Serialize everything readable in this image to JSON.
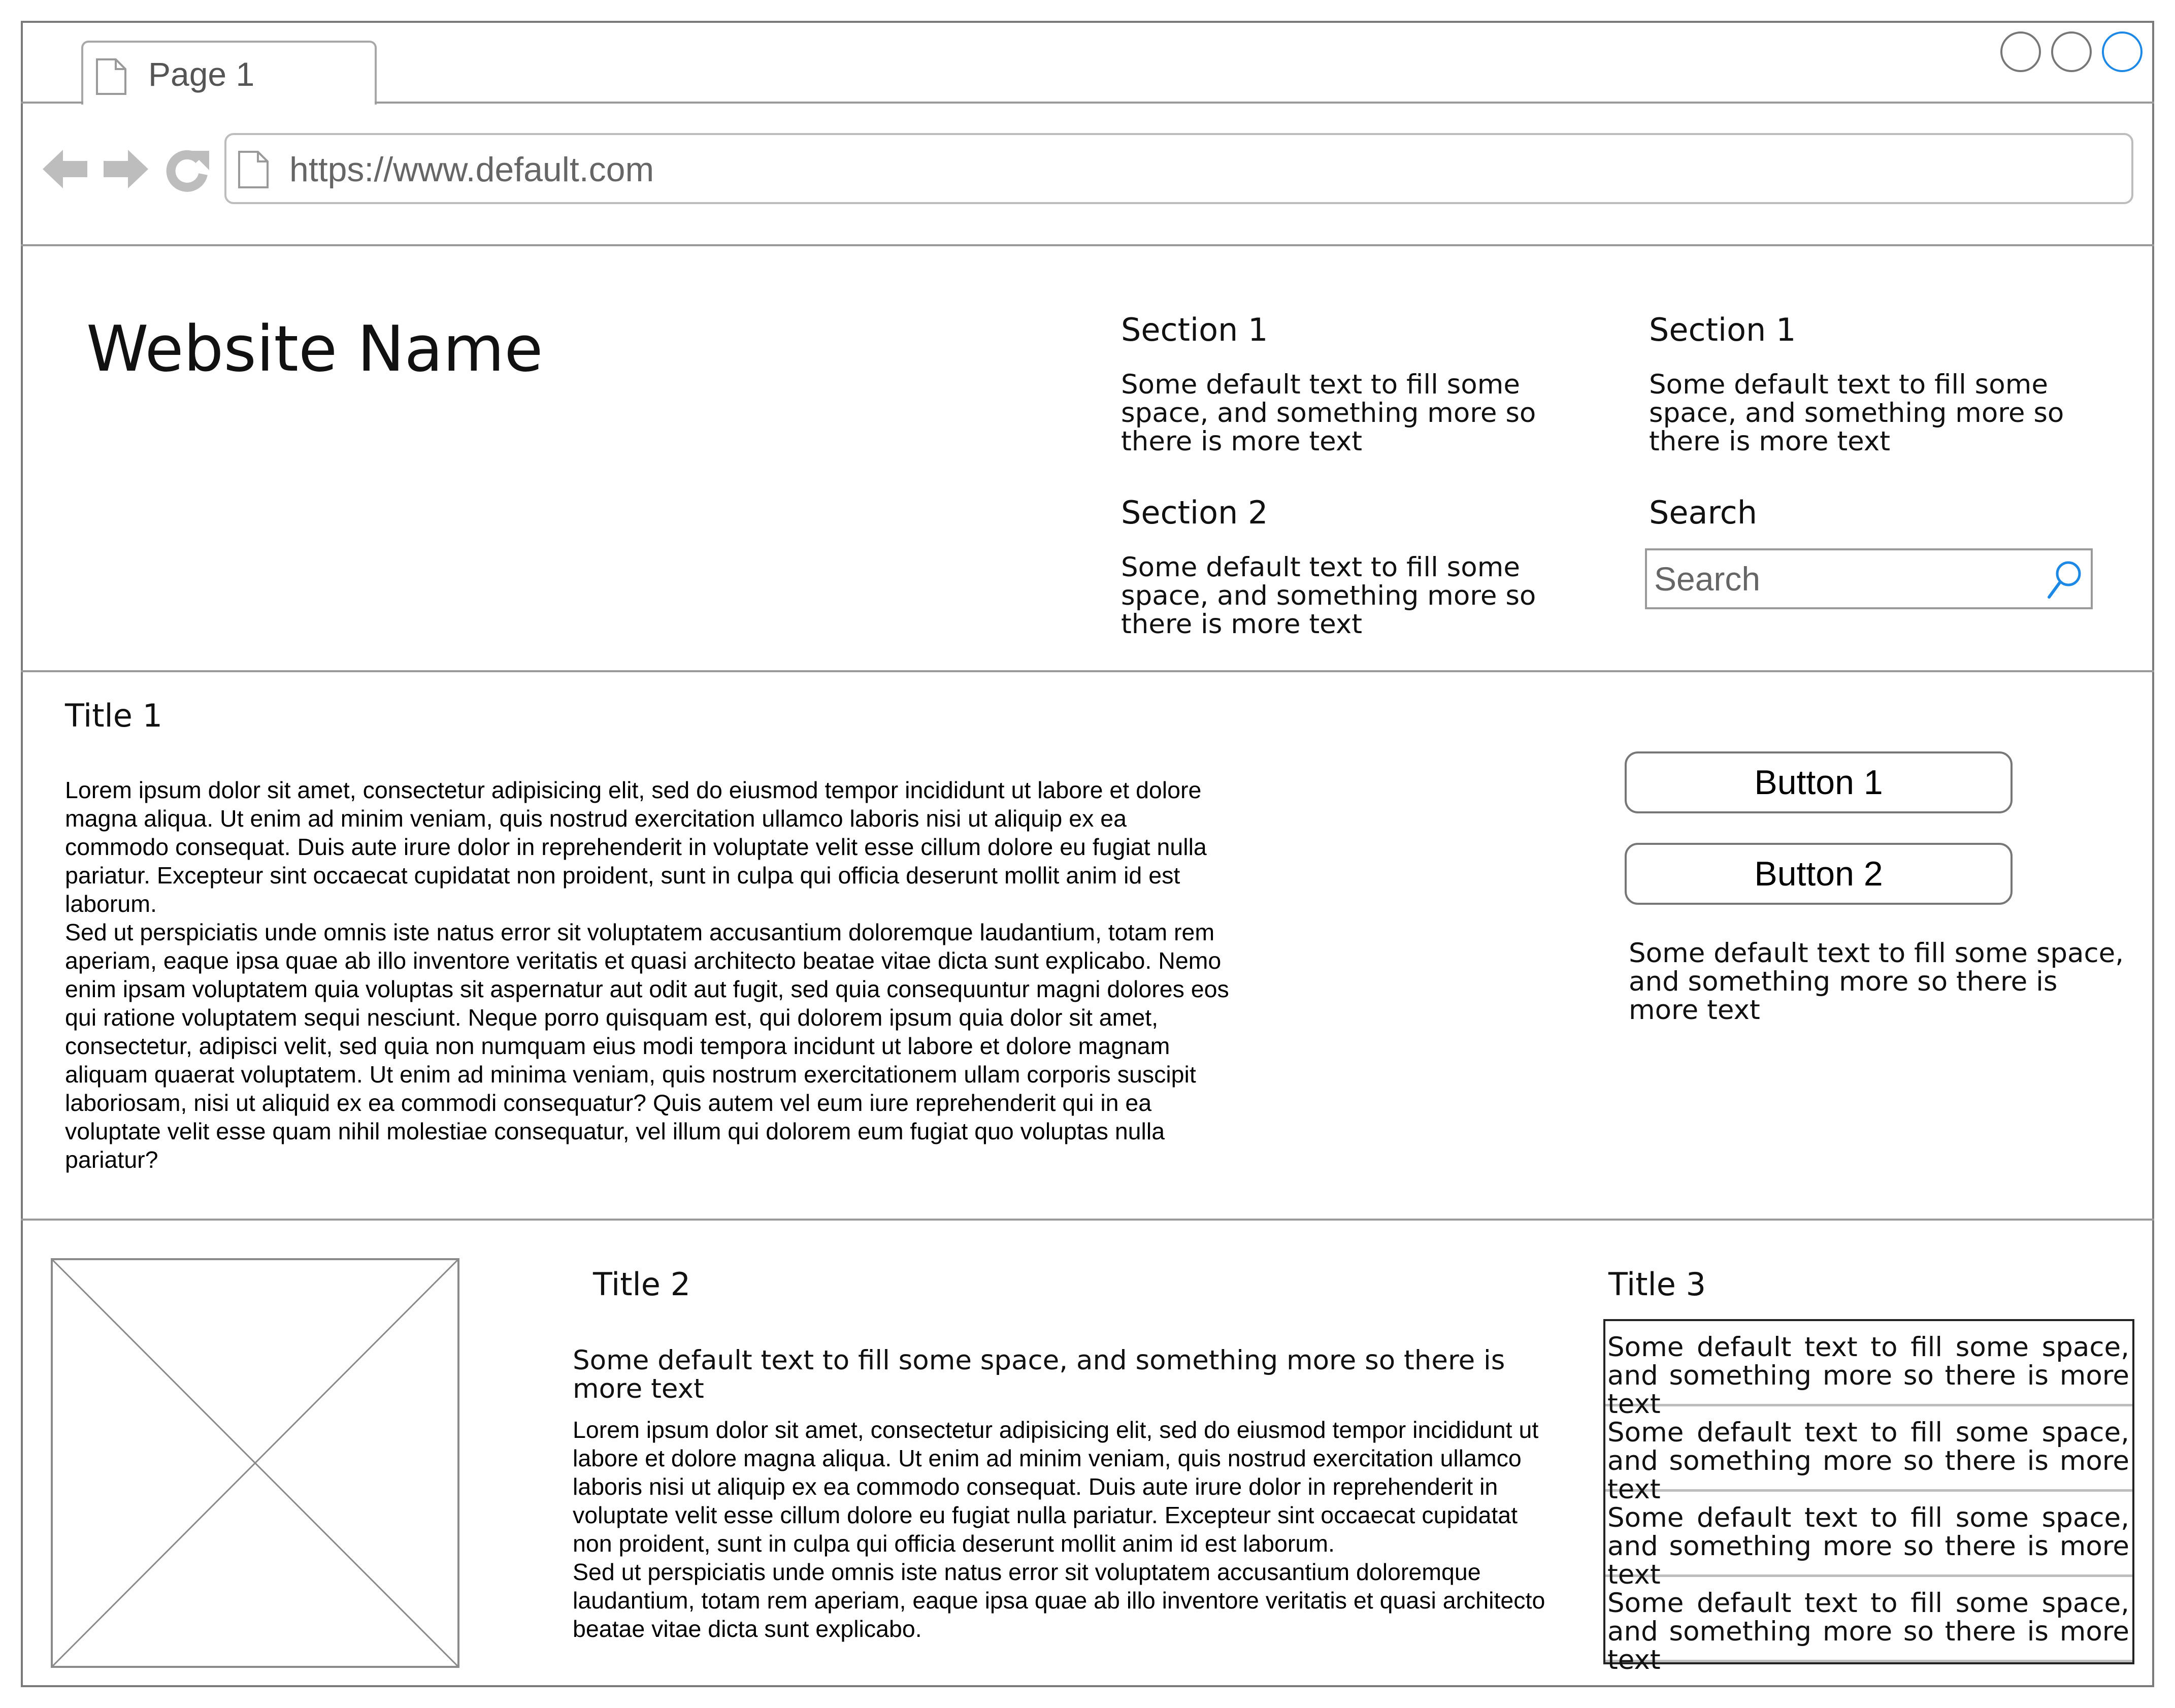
{
  "browser": {
    "tab_label": "Page 1",
    "url": "https://www.default.com",
    "accent_color": "#1e88e5"
  },
  "header": {
    "site_name": "Website Name",
    "sections": [
      {
        "title": "Section 1",
        "text": "Some default text to fill some space, and something more so there is more text"
      },
      {
        "title": "Section 1",
        "text": "Some default text to fill some space, and something more so there is more text"
      },
      {
        "title": "Section 2",
        "text": "Some default text to fill some space, and something more so there is more text"
      }
    ],
    "search": {
      "title": "Search",
      "placeholder": "Search"
    }
  },
  "main": {
    "title": "Title 1",
    "body": "Lorem ipsum dolor sit amet, consectetur adipisicing elit, sed do eiusmod tempor incididunt ut labore et dolore magna aliqua. Ut enim ad minim veniam, quis nostrud exercitation ullamco laboris nisi ut aliquip ex ea commodo consequat. Duis aute irure dolor in reprehenderit in voluptate velit esse cillum dolore eu fugiat nulla pariatur. Excepteur sint occaecat cupidatat non proident, sunt in culpa qui officia deserunt mollit anim id est laborum.\nSed ut perspiciatis unde omnis iste natus error sit voluptatem accusantium doloremque laudantium, totam rem aperiam, eaque ipsa quae ab illo inventore veritatis et quasi architecto beatae vitae dicta sunt explicabo. Nemo enim ipsam voluptatem quia voluptas sit aspernatur aut odit aut fugit, sed quia consequuntur magni dolores eos qui ratione voluptatem sequi nesciunt. Neque porro quisquam est, qui dolorem ipsum quia dolor sit amet, consectetur, adipisci velit, sed quia non numquam eius modi tempora incidunt ut labore et dolore magnam aliquam quaerat voluptatem. Ut enim ad minima veniam, quis nostrum exercitationem ullam corporis suscipit laboriosam, nisi ut aliquid ex ea commodi consequatur? Quis autem vel eum iure reprehenderit qui in ea voluptate velit esse quam nihil molestiae consequatur, vel illum qui dolorem eum fugiat quo voluptas nulla pariatur?",
    "button1_label": "Button 1",
    "button2_label": "Button 2",
    "side_text": "Some default text to fill some space, and something more so there is more text"
  },
  "bottom": {
    "title2": "Title 2",
    "subtitle2": "Some default text to fill some space, and something more so there is more text",
    "body2": "Lorem ipsum dolor sit amet, consectetur adipisicing elit, sed do eiusmod tempor incididunt ut labore et dolore magna aliqua. Ut enim ad minim veniam, quis nostrud exercitation ullamco laboris nisi ut aliquip ex ea commodo consequat. Duis aute irure dolor in reprehenderit in voluptate velit esse cillum dolore eu fugiat nulla pariatur. Excepteur sint occaecat cupidatat non proident, sunt in culpa qui officia deserunt mollit anim id est laborum.\nSed ut perspiciatis unde omnis iste natus error sit voluptatem accusantium doloremque laudantium, totam rem aperiam, eaque ipsa quae ab illo inventore veritatis et quasi architecto beatae vitae dicta sunt explicabo.",
    "title3": "Title 3",
    "list": [
      "Some default text to fill some space, and something more so there is more text",
      "Some default text to fill some space, and something more so there is more text",
      "Some default text to fill some space, and something more so there is more text",
      "Some default text to fill some space, and something more so there is more text"
    ]
  }
}
